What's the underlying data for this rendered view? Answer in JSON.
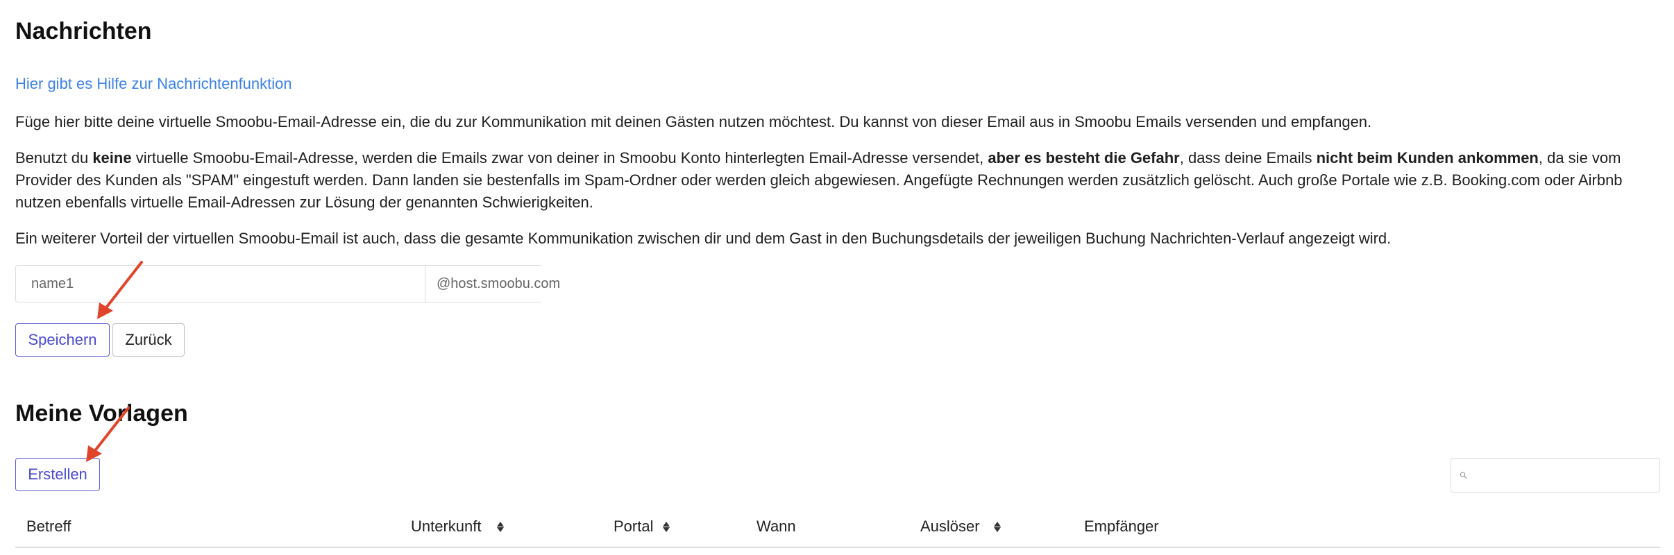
{
  "messages": {
    "title": "Nachrichten",
    "help_link": "Hier gibt es Hilfe zur Nachrichtenfunktion",
    "intro": "Füge hier bitte deine virtuelle Smoobu-Email-Adresse ein, die du zur Kommunikation mit deinen Gästen nutzen möchtest. Du kannst von dieser Email aus in  Smoobu Emails versenden und empfangen.",
    "warning": {
      "part1": "Benutzt du ",
      "bold1": "keine",
      "part2": " virtuelle Smoobu-Email-Adresse, werden die Emails zwar von deiner in Smoobu Konto hinterlegten Email-Adresse versendet, ",
      "bold2": "aber es besteht die Gefahr",
      "part3": ", dass deine Emails ",
      "bold3": "nicht beim Kunden ankommen",
      "part4": ", da sie vom Provider des Kunden als \"SPAM\" eingestuft werden. Dann landen sie bestenfalls im Spam-Ordner oder werden gleich abgewiesen. Angefügte Rechnungen werden zusätzlich gelöscht. Auch große Portale wie z.B. Booking.com oder Airbnb nutzen ebenfalls virtuelle Email-Adressen zur Lösung der genannten Schwierigkeiten."
    },
    "advantage": "Ein weiterer Vorteil der virtuellen Smoobu-Email ist auch, dass die gesamte Kommunikation zwischen dir und dem Gast in den Buchungsdetails der jeweiligen Buchung Nachrichten-Verlauf angezeigt wird.",
    "email_input": {
      "placeholder": "name1",
      "value": ""
    },
    "email_suffix": "@host.smoobu.com",
    "save_label": "Speichern",
    "back_label": "Zurück"
  },
  "templates": {
    "title": "Meine Vorlagen",
    "create_label": "Erstellen",
    "search": {
      "placeholder": ""
    },
    "columns": [
      {
        "label": "Betreff",
        "sortable": false
      },
      {
        "label": "Unterkunft",
        "sortable": true
      },
      {
        "label": "Portal",
        "sortable": true
      },
      {
        "label": "Wann",
        "sortable": false
      },
      {
        "label": "Auslöser",
        "sortable": true
      },
      {
        "label": "Empfänger",
        "sortable": false
      }
    ]
  },
  "colors": {
    "link": "#3b82e6",
    "primary_button": "#4a4ad0",
    "annotation_arrow": "#e0452b"
  },
  "icons": {
    "search": "search-icon",
    "sort": "sort-icon",
    "annotation": "annotation-arrow-icon"
  }
}
